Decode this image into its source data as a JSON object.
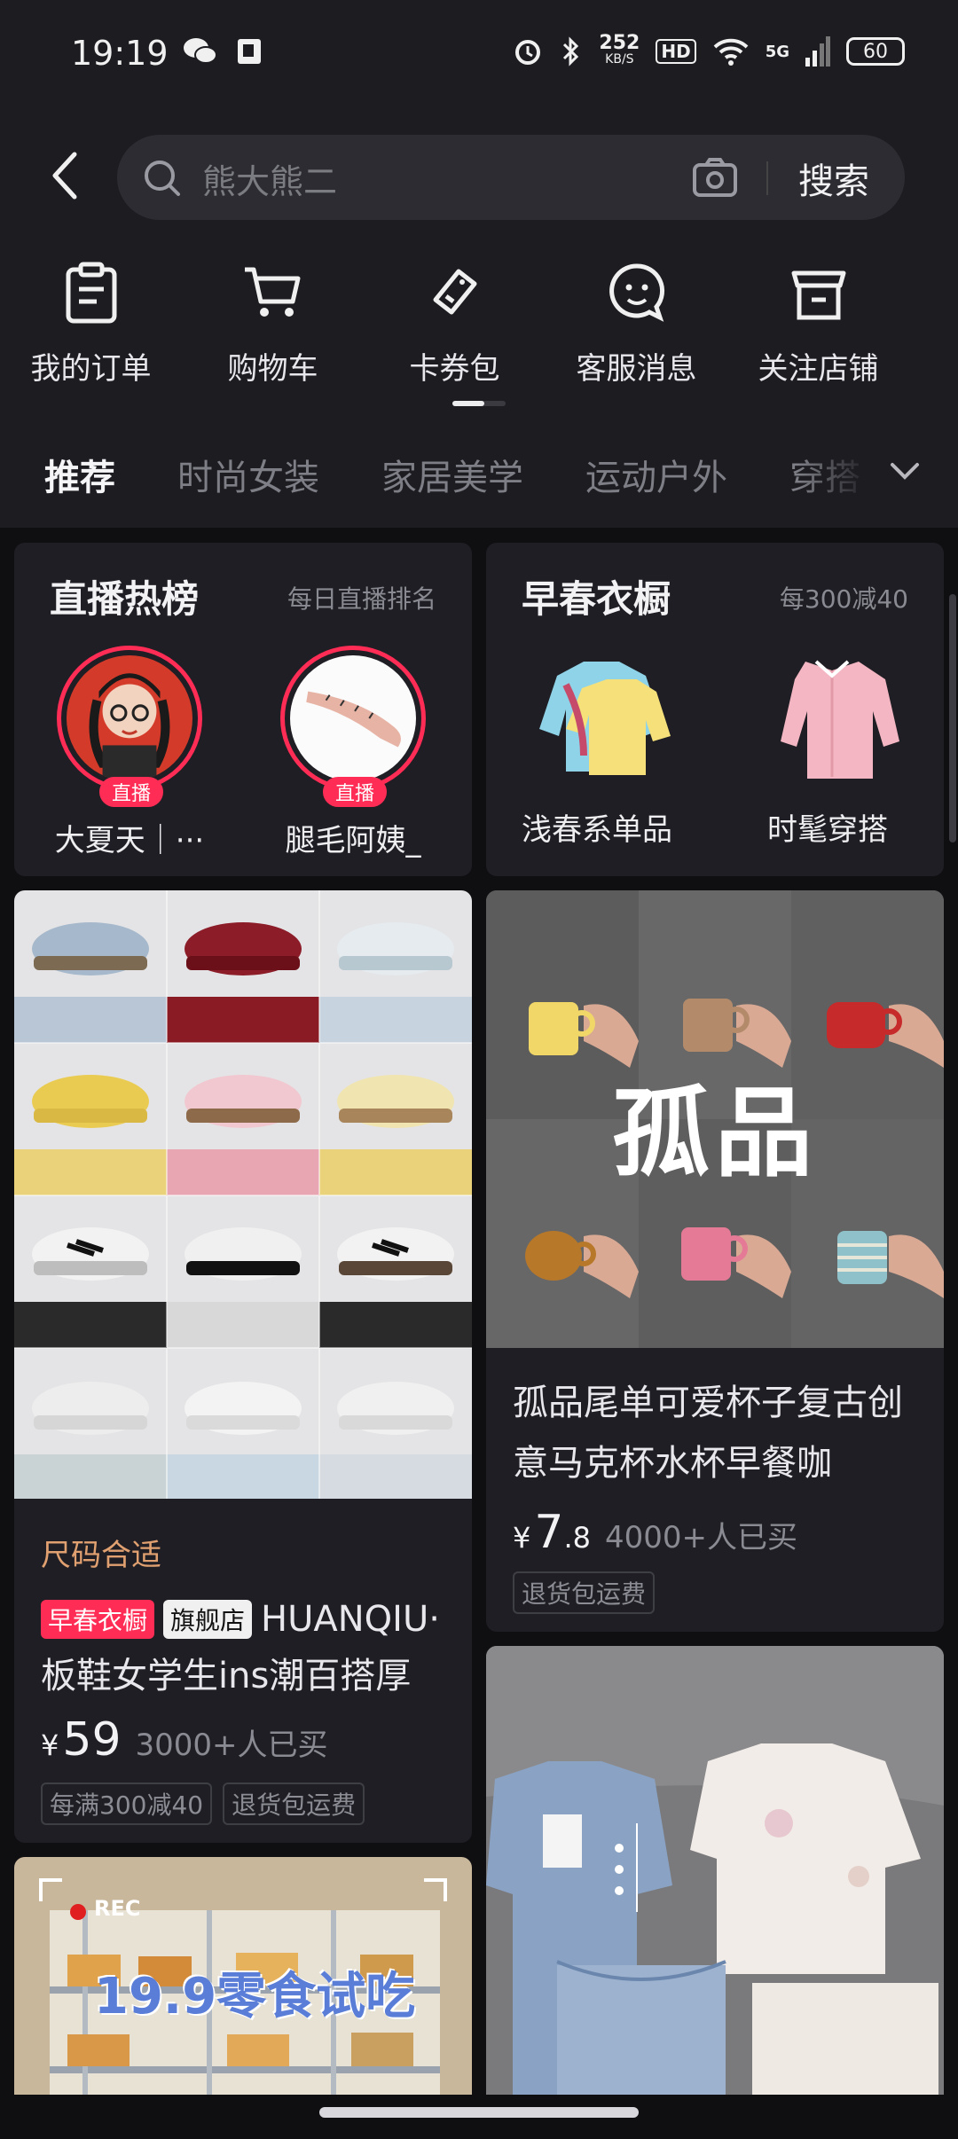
{
  "status_bar": {
    "time": "19:19",
    "network_speed_value": "252",
    "network_speed_unit": "KB/S",
    "hd_label": "HD",
    "network_type": "5G",
    "battery": "60"
  },
  "search": {
    "placeholder": "熊大熊二",
    "button_label": "搜索"
  },
  "shortcuts": [
    {
      "label": "我的订单",
      "icon": "clipboard-icon"
    },
    {
      "label": "购物车",
      "icon": "cart-icon"
    },
    {
      "label": "卡券包",
      "icon": "coupon-icon"
    },
    {
      "label": "客服消息",
      "icon": "chat-icon"
    },
    {
      "label": "关注店铺",
      "icon": "store-icon"
    }
  ],
  "tabs": [
    "推荐",
    "时尚女装",
    "家居美学",
    "运动户外",
    "穿搭"
  ],
  "live_card": {
    "title": "直播热榜",
    "subtitle": "每日直播排名",
    "items": [
      {
        "name": "大夏天｜···",
        "badge": "直播"
      },
      {
        "name": "腿毛阿姨_",
        "badge": "直播"
      }
    ]
  },
  "spring_card": {
    "title": "早春衣橱",
    "subtitle": "每300减40",
    "items": [
      {
        "name": "浅春系单品"
      },
      {
        "name": "时髦穿搭"
      }
    ]
  },
  "product_shoes": {
    "size_hint": "尺码合适",
    "badge1": "早春衣橱",
    "badge2": "旗舰店",
    "title_line1": "HUANQIU·",
    "title_line2": "板鞋女学生ins潮百搭厚",
    "currency": "¥",
    "price": "59",
    "sold": "3000+人已买",
    "tags": [
      "每满300减40",
      "退货包运费"
    ]
  },
  "product_cups": {
    "overlay_text": "孤品",
    "title": "孤品尾单可爱杯子复古创意马克杯水杯早餐咖",
    "currency": "¥",
    "price_int": "7",
    "price_dec": ".8",
    "sold": "4000+人已买",
    "tags": [
      "退货包运费"
    ]
  },
  "product_snack": {
    "rec_label": "REC",
    "banner_text": "19.9零食试吃"
  },
  "colors": {
    "background": "#0f0f12",
    "card": "#1e1e24",
    "accent_red": "#ff2d55",
    "size_hint": "#e0a070"
  }
}
